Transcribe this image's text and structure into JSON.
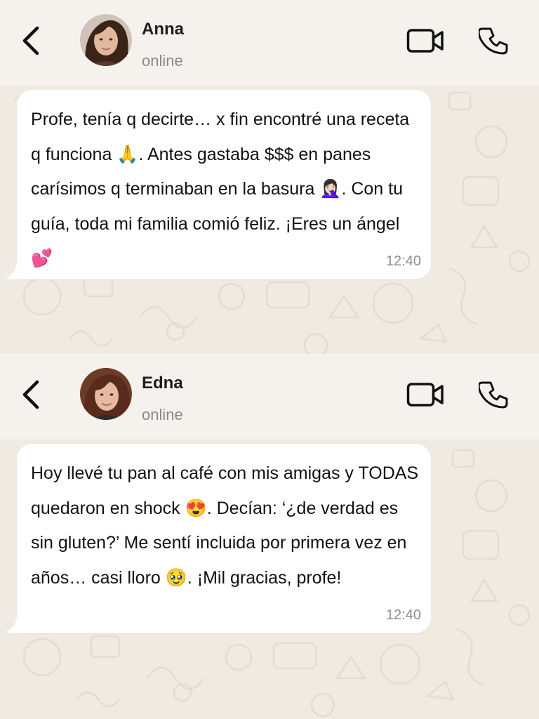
{
  "chats": [
    {
      "contact_name": "Anna",
      "status": "online",
      "message": "Profe, tenía q decirte… x fin encontré una receta q funciona 🙏. Antes gastaba $$$ en panes carísimos q terminaban en la basura 🤦🏻‍♀️. Con tu guía, toda mi familia comió feliz. ¡Eres un ángel 💕",
      "time": "12:40"
    },
    {
      "contact_name": "Edna",
      "status": "online",
      "message": "Hoy llevé tu pan al café con mis amigas y TODAS quedaron en shock 😍. Decían: ‘¿de verdad es sin gluten?’ Me sentí incluida por primera vez en años… casi lloro 🥹. ¡Mil gracias, profe!",
      "time": "12:40"
    }
  ],
  "icons": {
    "back": "chevron-left-icon",
    "video": "video-camera-icon",
    "call": "phone-icon"
  },
  "colors": {
    "header_bg": "#f5f2ee",
    "chat_bg": "#efeae2",
    "bubble_bg": "#ffffff",
    "status_text": "#8a8a8a"
  }
}
